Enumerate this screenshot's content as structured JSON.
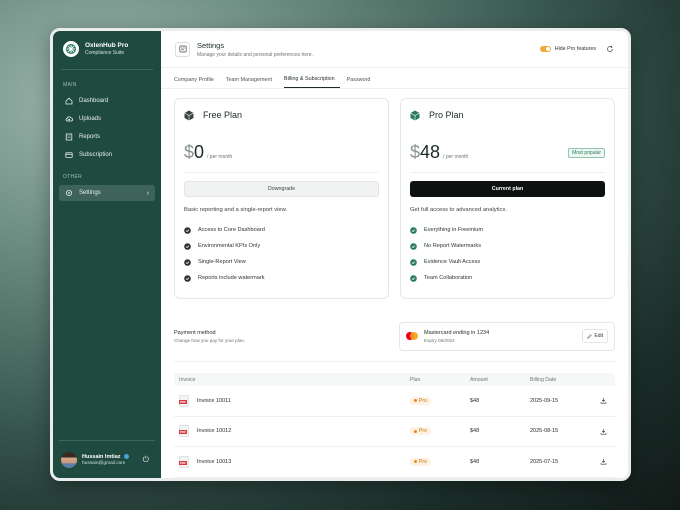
{
  "brand": {
    "name": "OxlenHub Pro",
    "subtitle": "Compliance Suite"
  },
  "sidebar": {
    "main_label": "MAIN",
    "items": [
      {
        "label": "Dashboard",
        "icon": "home-icon"
      },
      {
        "label": "Uploads",
        "icon": "cloud-upload-icon"
      },
      {
        "label": "Reports",
        "icon": "report-icon"
      },
      {
        "label": "Subscription",
        "icon": "card-icon"
      }
    ],
    "other_label": "OTHER",
    "settings_label": "Settings"
  },
  "user": {
    "name": "Hussain Imtiaz",
    "email": "hussain@gmail.com"
  },
  "header": {
    "title": "Settings",
    "subtitle": "Manage your details and personal preferences here.",
    "toggle_label": "Hide Pro features",
    "toggle_on": true
  },
  "tabs": [
    {
      "label": "Company Profile"
    },
    {
      "label": "Team Management"
    },
    {
      "label": "Billing & Subscription",
      "active": true
    },
    {
      "label": "Password"
    }
  ],
  "plans": {
    "free": {
      "name": "Free Plan",
      "currency": "$",
      "amount": "0",
      "period": "/ per month",
      "button": "Downgrade",
      "description": "Basic reporting and a single-report view.",
      "features": [
        "Access to Core Dashboard",
        "Environmental KPIs Only",
        "Single-Report View",
        "Reports include watermark"
      ]
    },
    "pro": {
      "name": "Pro Plan",
      "currency": "$",
      "amount": "48",
      "period": "/ per month",
      "badge": "Most popular",
      "button": "Current plan",
      "description": "Get full access to advanced analytics.",
      "features": [
        "Everything in Freemium",
        "No Report Watermarks",
        "Evidence Vault Access",
        "Team Collaboration"
      ]
    }
  },
  "payment": {
    "title": "Payment method",
    "subtitle": "Change how you pay for your plan.",
    "card_name": "Mastercard ending in 1234",
    "card_expiry": "Expiry 06/2024",
    "edit_label": "Edit"
  },
  "invoices": {
    "headers": {
      "invoice": "Invoice",
      "plan": "Plan",
      "amount": "Amount",
      "date": "Billing Date"
    },
    "rows": [
      {
        "name": "Invoice 10011",
        "plan": "Pro",
        "amount": "$48",
        "date": "2025-09-15"
      },
      {
        "name": "Invoice 10012",
        "plan": "Pro",
        "amount": "$48",
        "date": "2025-08-15"
      },
      {
        "name": "Invoice 10013",
        "plan": "Pro",
        "amount": "$48",
        "date": "2025-07-15"
      }
    ]
  },
  "colors": {
    "sidebar_bg": "#1f4a40",
    "accent_orange": "#f0a93a",
    "pro_green": "#2b7a5c",
    "dark_button": "#0d1110"
  }
}
